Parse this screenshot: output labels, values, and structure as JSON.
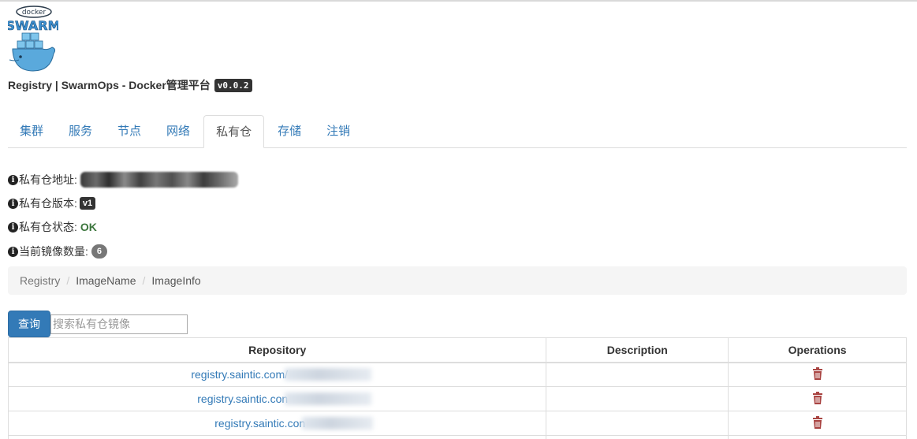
{
  "app": {
    "title": "Registry | SwarmOps - Docker管理平台",
    "version": "v0.0.2",
    "logo_text": "docker SWARM"
  },
  "tabs": [
    {
      "label": "集群",
      "active": false
    },
    {
      "label": "服务",
      "active": false
    },
    {
      "label": "节点",
      "active": false
    },
    {
      "label": "网络",
      "active": false
    },
    {
      "label": "私有仓",
      "active": true
    },
    {
      "label": "存储",
      "active": false
    },
    {
      "label": "注销",
      "active": false
    }
  ],
  "info": {
    "address_label": "私有仓地址:",
    "version_label": "私有仓版本:",
    "version_value": "v1",
    "status_label": "私有仓状态:",
    "status_value": "OK",
    "count_label": "当前镜像数量:",
    "count_value": "6"
  },
  "breadcrumb": [
    "Registry",
    "ImageName",
    "ImageInfo"
  ],
  "search": {
    "button_label": "查询",
    "placeholder": "搜索私有仓镜像"
  },
  "table": {
    "headers": [
      "Repository",
      "Description",
      "Operations"
    ],
    "rows": [
      {
        "repository": "registry.saintic.com/",
        "description": ""
      },
      {
        "repository": "registry.saintic.con",
        "description": ""
      },
      {
        "repository": "registry.saintic.con",
        "description": ""
      }
    ]
  },
  "colors": {
    "link": "#337ab7",
    "status_ok": "#3c763d",
    "delete_icon": "#a94442"
  }
}
